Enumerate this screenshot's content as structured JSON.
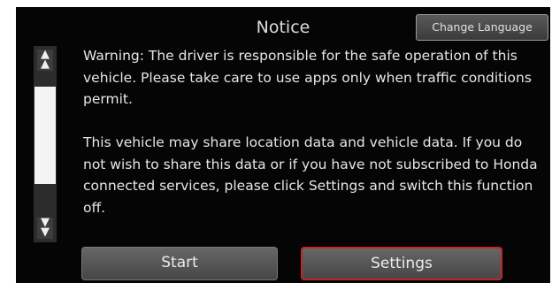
{
  "dialog": {
    "title": "Notice",
    "change_language_label": "Change Language",
    "paragraphs": [
      "Warning: The driver is responsible for the safe operation of this vehicle. Please take care to use apps only when traffic conditions permit.",
      "This vehicle may share location data and vehicle data. If you do not wish to share this data or if you have not subscribed to Honda connected services, please click Settings and switch this function off."
    ],
    "start_label": "Start",
    "settings_label": "Settings"
  },
  "scrollbar": {
    "up_icon": "double-chevron-up-icon",
    "down_icon": "double-chevron-down-icon"
  },
  "colors": {
    "background": "#050505",
    "text": "#e6e6e6",
    "button": "#555555",
    "selected_border": "#c0262c"
  }
}
